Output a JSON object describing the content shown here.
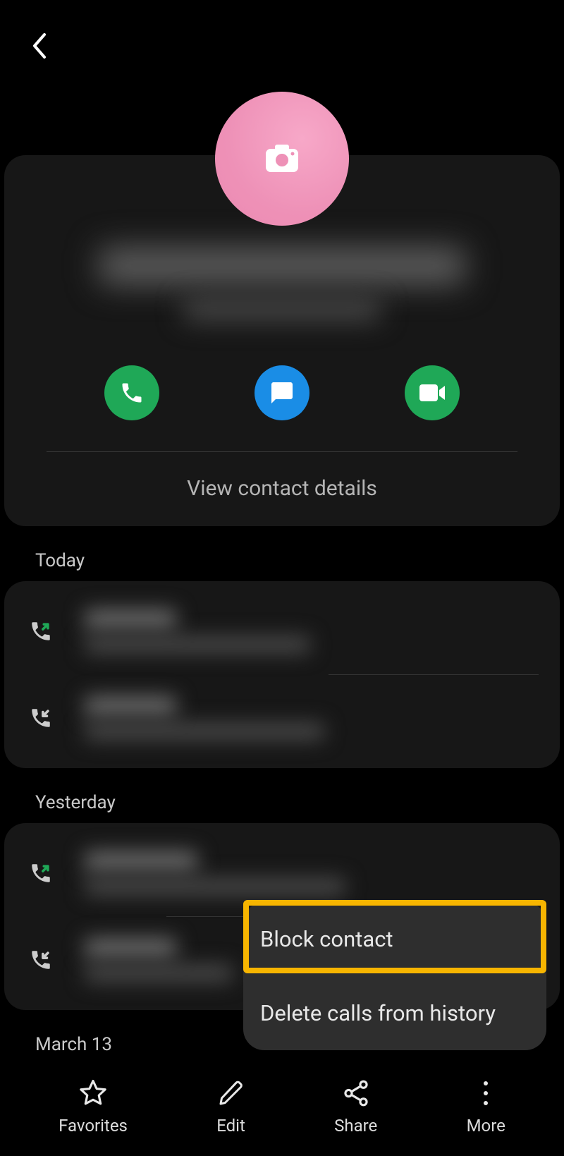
{
  "contact": {
    "name_blurred": true,
    "subline_blurred": true,
    "view_details_label": "View contact details"
  },
  "sections": {
    "today_label": "Today",
    "yesterday_label": "Yesterday",
    "march13_label": "March 13"
  },
  "context_menu": {
    "block_label": "Block contact",
    "delete_label": "Delete calls from history"
  },
  "bottom_nav": {
    "favorites": "Favorites",
    "edit": "Edit",
    "share": "Share",
    "more": "More"
  }
}
